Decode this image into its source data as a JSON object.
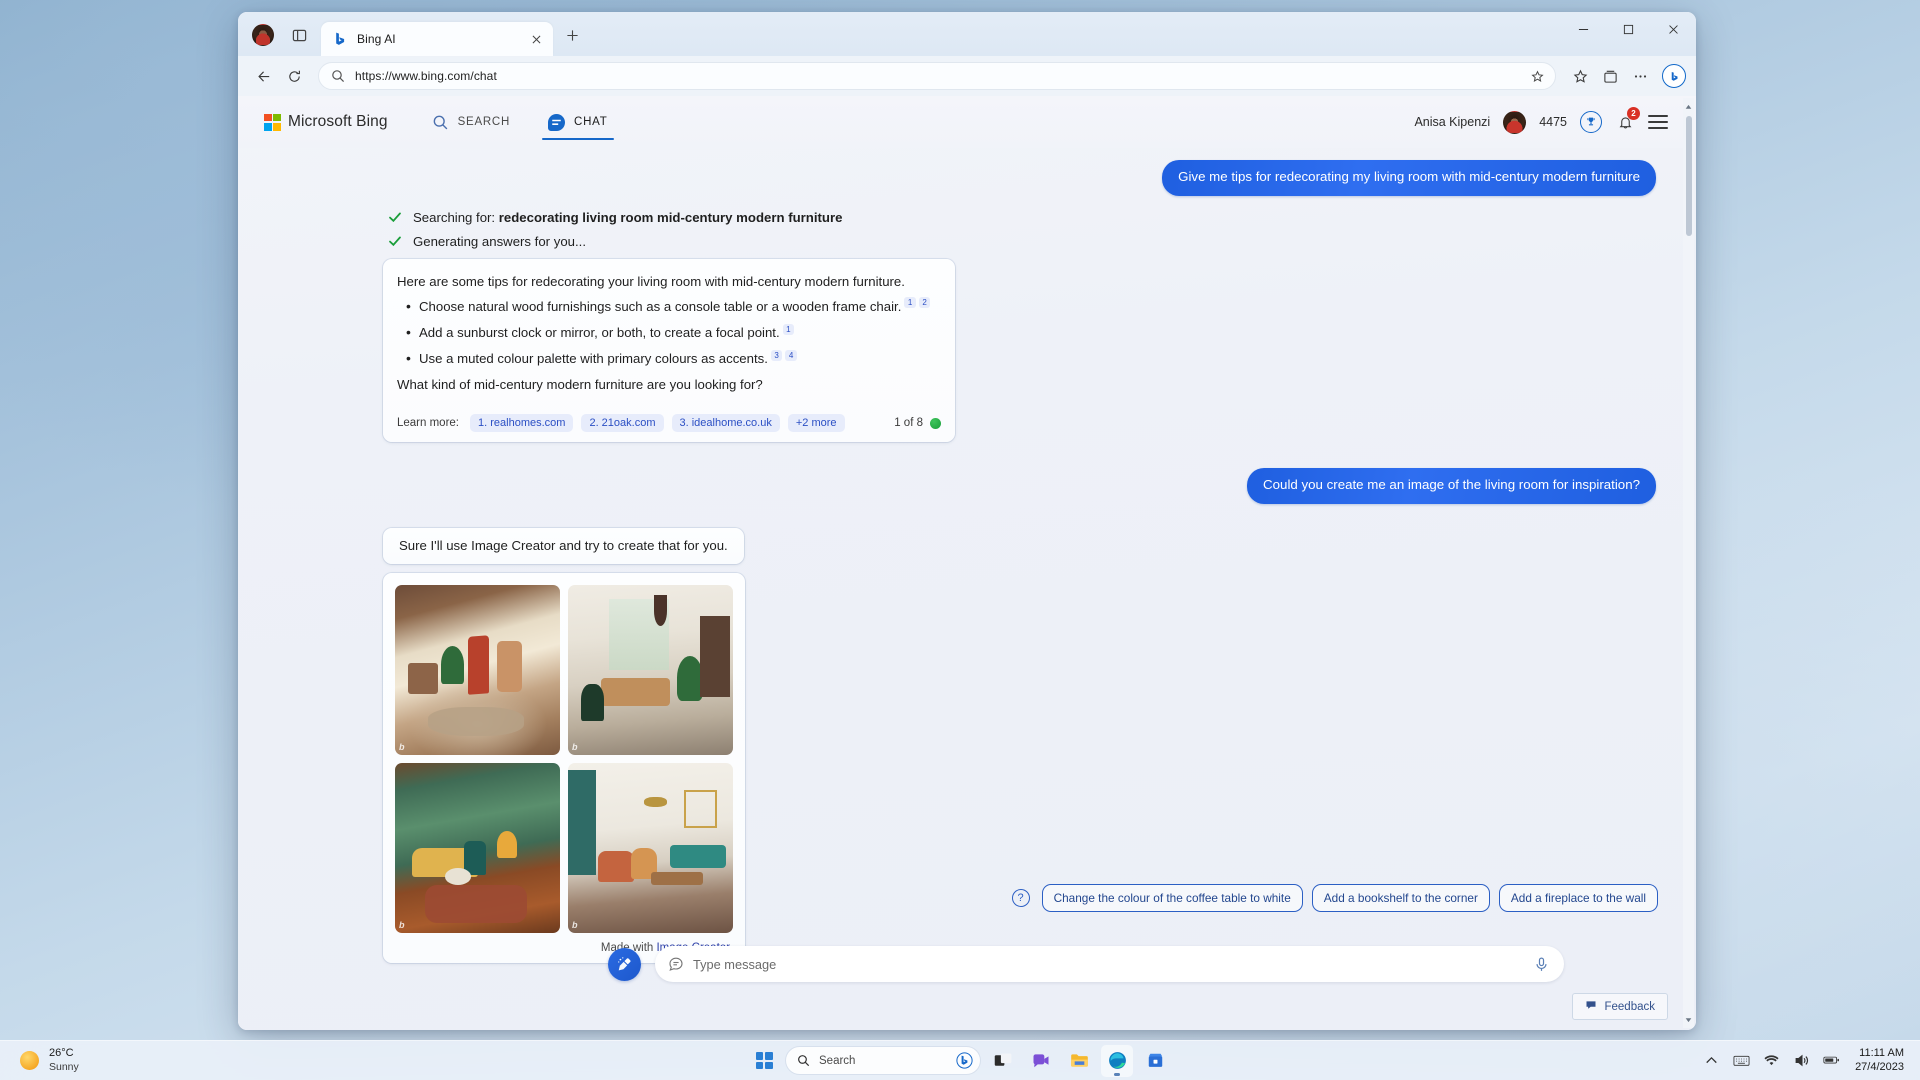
{
  "browser": {
    "tab": {
      "title": "Bing AI",
      "favicon": "bing-favicon"
    },
    "new_tab_label": "+",
    "url": "https://www.bing.com/chat",
    "window_controls": {
      "minimize": "minimize-icon",
      "maximize": "maximize-icon",
      "close": "close-icon"
    }
  },
  "bing_header": {
    "brand": "Microsoft Bing",
    "tabs": [
      {
        "label": "SEARCH",
        "icon": "search-icon",
        "active": false
      },
      {
        "label": "CHAT",
        "icon": "chat-icon",
        "active": true
      }
    ],
    "user_name": "Anisa Kipenzi",
    "points": "4475",
    "reward_icon": "trophy-icon",
    "notification_count": "2",
    "menu_icon": "hamburger-icon"
  },
  "conversation": {
    "messages": [
      {
        "role": "user",
        "text": "Give me tips for redecorating my living room with mid-century modern furniture"
      }
    ],
    "status_lines": [
      "Searching for: ",
      "Generating answers for you..."
    ],
    "search_query": "redecorating living room mid-century modern furniture",
    "answer": {
      "intro": "Here are some tips for redecorating your living room with mid-century modern furniture.",
      "bullets": [
        {
          "text": "Choose natural wood furnishings such as a console table or a wooden frame chair.",
          "citations": [
            "1",
            "2"
          ]
        },
        {
          "text": "Add a sunburst clock or mirror, or both, to create a focal point.",
          "citations": [
            "1"
          ]
        },
        {
          "text": "Use a muted colour palette with primary colours as accents.",
          "citations": [
            "3",
            "4"
          ]
        }
      ],
      "closing": "What kind of mid-century modern furniture are you looking for?",
      "learn_more_label": "Learn more:",
      "sources": [
        "1. realhomes.com",
        "2. 21oak.com",
        "3. idealhome.co.uk",
        "+2 more"
      ],
      "counter": "1 of 8"
    },
    "second_user_message": "Could you create me an image of the living room for inspiration?",
    "bot_reply": "Sure I'll use Image Creator and try to create that for you.",
    "image_card": {
      "images": [
        {
          "alt": "mid-century living room with red chairs and large windows",
          "stamp": "b"
        },
        {
          "alt": "modern living room with tan sofa and pendant lamp",
          "stamp": "b"
        },
        {
          "alt": "retro living room with yellow sofa and green chair",
          "stamp": "b"
        },
        {
          "alt": "minimal living room with teal sofa and wood coffee table",
          "stamp": "b"
        }
      ],
      "caption_prefix": "Made with ",
      "caption_link": "Image Creator"
    }
  },
  "suggestions": {
    "help_icon": "question-mark-icon",
    "chips": [
      "Change the colour of the coffee table to white",
      "Add a bookshelf to the corner",
      "Add a fireplace to the wall"
    ]
  },
  "composer": {
    "new_topic_icon": "broom-icon",
    "lead_icon": "chat-message-icon",
    "placeholder": "Type message",
    "mic_icon": "microphone-icon"
  },
  "feedback": {
    "label": "Feedback",
    "icon": "feedback-icon"
  },
  "taskbar": {
    "weather": {
      "temperature": "26°C",
      "condition": "Sunny",
      "icon": "sun-icon"
    },
    "start_icon": "windows-start-icon",
    "search_placeholder": "Search",
    "search_bing_icon": "bing-icon",
    "apps": [
      {
        "name": "teams-icon"
      },
      {
        "name": "chat-video-icon"
      },
      {
        "name": "file-explorer-icon"
      },
      {
        "name": "edge-icon"
      },
      {
        "name": "microsoft-store-icon"
      }
    ],
    "tray": [
      {
        "name": "show-hidden-icons-icon"
      },
      {
        "name": "keyboard-layout-icon"
      },
      {
        "name": "wifi-icon"
      },
      {
        "name": "volume-icon"
      },
      {
        "name": "battery-icon"
      }
    ],
    "clock": {
      "time": "11:11 AM",
      "date": "27/4/2023"
    }
  },
  "colors": {
    "accent_blue": "#1668c9",
    "user_bubble": "#2463e0",
    "link_blue": "#2b4fc4",
    "status_green": "#1a9e3a",
    "badge_red": "#d93025"
  }
}
